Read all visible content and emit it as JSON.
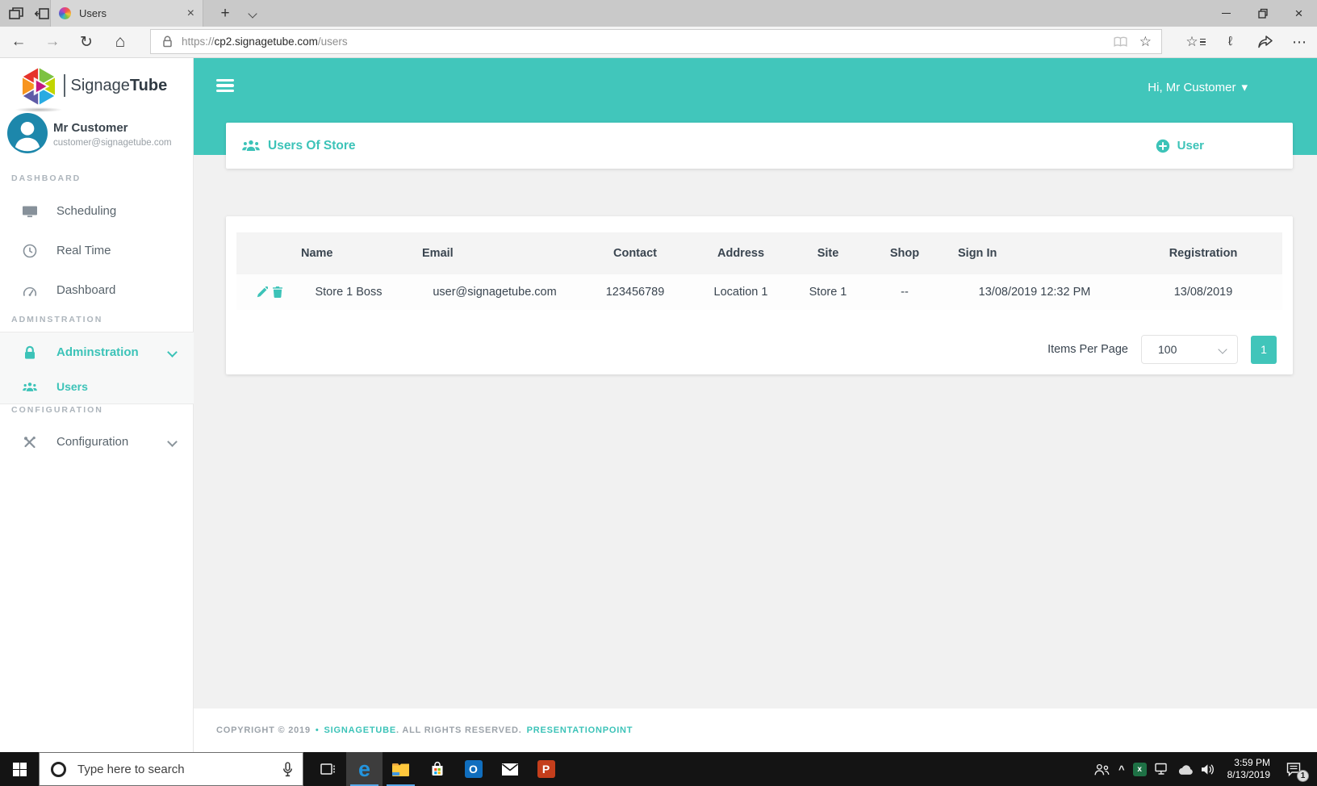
{
  "browser": {
    "tab": {
      "title": "Users"
    },
    "url": {
      "scheme": "https://",
      "host": "cp2.signagetube.com",
      "path": "/users"
    }
  },
  "sidebar": {
    "brand": {
      "first": "Signage",
      "second": "Tube"
    },
    "user": {
      "name": "Mr Customer",
      "email": "customer@signagetube.com"
    },
    "section_labels": {
      "dashboard": "DASHBOARD",
      "administration": "ADMINSTRATION",
      "configuration": "CONFIGURATION"
    },
    "items": {
      "scheduling": "Scheduling",
      "real_time": "Real Time",
      "dashboard": "Dashboard",
      "administration": "Adminstration",
      "users": "Users",
      "configuration": "Configuration"
    }
  },
  "header": {
    "greeting": "Hi, Mr Customer"
  },
  "panel": {
    "title": "Users Of Store",
    "add_user_label": "User"
  },
  "table": {
    "headers": [
      "Name",
      "Email",
      "Contact",
      "Address",
      "Site",
      "Shop",
      "Sign In",
      "Registration"
    ],
    "rows": [
      {
        "name": "Store 1 Boss",
        "email": "user@signagetube.com",
        "contact": "123456789",
        "address": "Location 1",
        "site": "Store 1",
        "shop": "--",
        "sign_in": "13/08/2019 12:32 PM",
        "registration": "13/08/2019"
      }
    ]
  },
  "pagination": {
    "items_per_page_label": "Items Per Page",
    "items_per_page_value": "100",
    "current_page": "1"
  },
  "footer": {
    "copyright": "COPYRIGHT © 2019",
    "separator": "•",
    "brand": "SIGNAGETUBE",
    "rights": ". ALL RIGHTS RESERVED.",
    "partner": "PRESENTATIONPOINT"
  },
  "taskbar": {
    "search_placeholder": "Type here to search",
    "time": "3:59 PM",
    "date": "8/13/2019",
    "notification_count": "1"
  },
  "colors": {
    "accent": "#3CC3B8",
    "header_teal": "#41C6BB",
    "avatar_blue": "#1D87AB",
    "edge_blue": "#2394DD"
  },
  "glyphs": {
    "close": "×",
    "plus": "+",
    "back": "←",
    "forward": "→",
    "refresh": "↻",
    "home": "⌂",
    "star": "☆",
    "pen": "ℓ",
    "ellipsis": "⋯",
    "caret_down": "▾",
    "chevron_up": "^",
    "edge_logo": "e",
    "outlook_logo": "O",
    "powerpoint_logo": "P",
    "excel_logo": "x"
  }
}
